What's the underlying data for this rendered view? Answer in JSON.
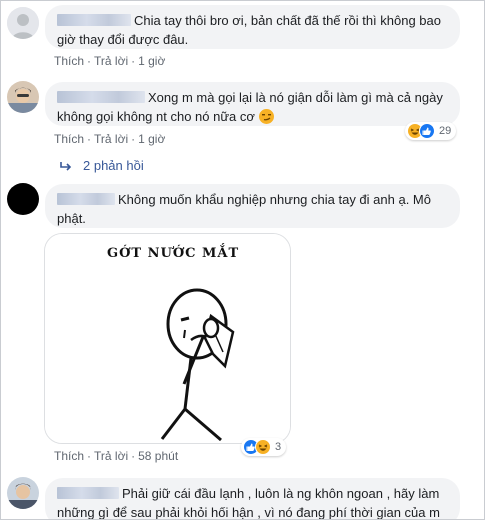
{
  "comments": [
    {
      "text": "Chia tay thôi bro ơi, bản chất đã thế rồi thì không bao giờ thay đổi được đâu.",
      "actions": {
        "like": "Thích",
        "reply": "Trả lời",
        "time": "1 giờ"
      }
    },
    {
      "text": "Xong m mà gọi lại là nó giận dỗi làm gì mà cả ngày không gọi không nt cho nó nữa cơ",
      "emoji": "😏",
      "actions": {
        "like": "Thích",
        "reply": "Trả lời",
        "time": "1 giờ"
      },
      "reaction_count": "29",
      "replies_link": "2 phản hồi"
    },
    {
      "text": "Không muốn khẩu nghiệp nhưng chia tay đi anh ạ. Mô phật.",
      "meme_caption": "GỚT NƯỚC MẮT",
      "actions": {
        "like": "Thích",
        "reply": "Trả lời",
        "time": "58 phút"
      },
      "reaction_count": "3"
    },
    {
      "text": "Phải giữ cái đầu lạnh , luôn là ng khôn ngoan , hãy làm những gì để sau phải khỏi hối hận , vì nó đang phí thời gian của m ai"
    }
  ],
  "colors": {
    "bubble": "#f2f3f5",
    "link_blue": "#385898",
    "meta_gray": "#606770",
    "like_blue": "#1877f2",
    "haha_yellow": "#f7b125"
  }
}
